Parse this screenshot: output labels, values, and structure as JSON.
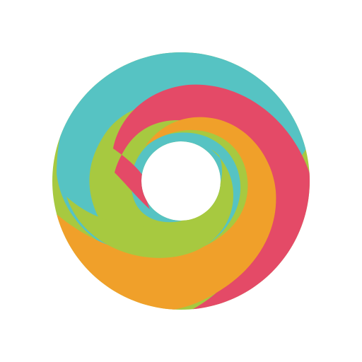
{
  "logo": {
    "icon": "swirl-ring-logo-icon",
    "colors": {
      "green": "#A7C940",
      "teal": "#56C3C3",
      "red": "#E44A67",
      "orange": "#F0A02A",
      "background": "#FFFFFF"
    }
  }
}
